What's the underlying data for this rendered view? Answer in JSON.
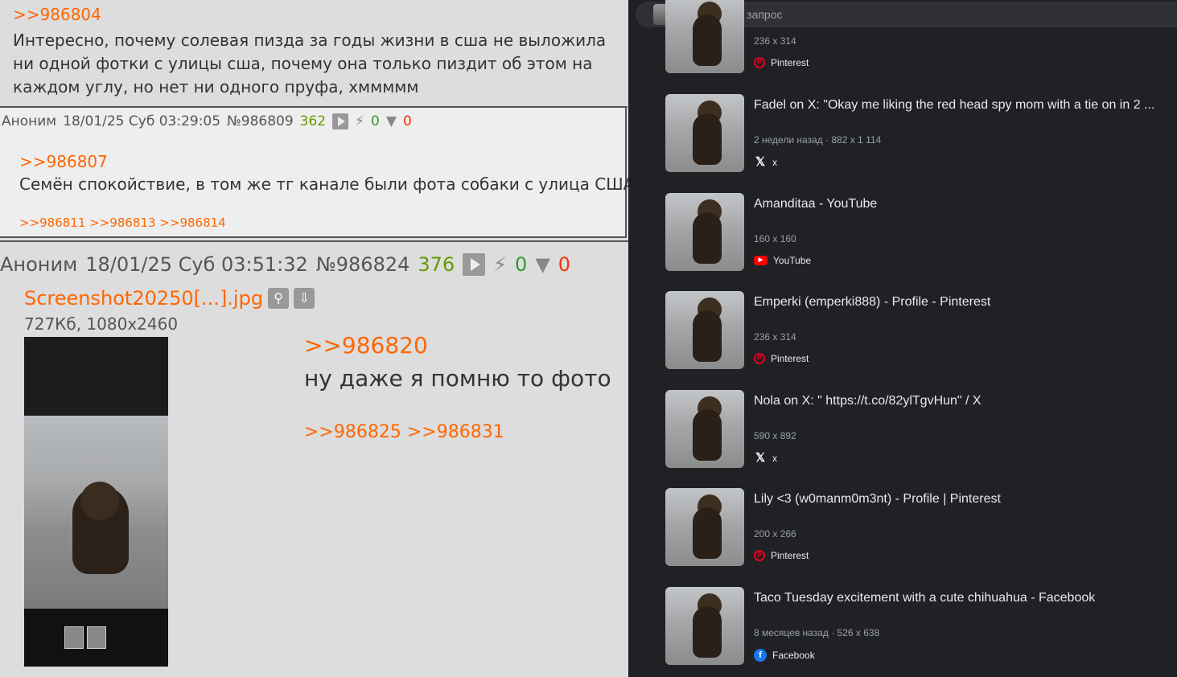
{
  "left": {
    "post1": {
      "reply": ">>986804",
      "text_line1": "Интересно, почему солевая пизда за годы жизни в сша не выложила",
      "text_line2": "ни одной фотки с улицы сша, почему она только пиздит об этом на",
      "text_line3": "каждом углу, но нет ни одного пруфа, хммммм"
    },
    "post2": {
      "author": "Аноним",
      "date": "18/01/25 Суб 03:29:05",
      "number": "№986809",
      "count": "362",
      "likes": "0",
      "dislikes": "0",
      "reply": ">>986807",
      "text": "Семён спокойствие, в том же тг канале были фота собаки с улица США",
      "replies": ">>986811 >>986813 >>986814"
    },
    "post3": {
      "author": "Аноним",
      "date": "18/01/25 Суб 03:51:32",
      "number": "№986824",
      "count": "376",
      "likes": "0",
      "dislikes": "0",
      "file_name": "Screenshot20250[...].jpg",
      "file_info": "727Кб, 1080x2460",
      "reply": ">>986820",
      "text": "ну даже я помню то фото",
      "replies": ">>986825 >>986831"
    }
  },
  "right": {
    "search": {
      "placeholder": "Дополните запрос"
    },
    "results": [
      {
        "title": "",
        "meta": "236 x 314",
        "source": "Pinterest",
        "icon": "pinterest-icon"
      },
      {
        "title": "Fadel on X: \"Okay me liking the red head spy mom with a tie on in 2 ...",
        "meta": "2 недели назад · 882 x 1 114",
        "source": "x",
        "icon": "x-icon"
      },
      {
        "title": "Amanditaa - YouTube",
        "meta": "160 x 160",
        "source": "YouTube",
        "icon": "youtube-icon"
      },
      {
        "title": "Emperki (emperki888) - Profile - Pinterest",
        "meta": "236 x 314",
        "source": "Pinterest",
        "icon": "pinterest-icon"
      },
      {
        "title": "Nola on X: \" https://t.co/82ylTgvHun\" / X",
        "meta": "590 x 892",
        "source": "x",
        "icon": "x-icon"
      },
      {
        "title": "Lily <3 (w0manm0m3nt) - Profile | Pinterest",
        "meta": "200 x 266",
        "source": "Pinterest",
        "icon": "pinterest-icon"
      },
      {
        "title": "Taco Tuesday excitement with a cute chihuahua - Facebook",
        "meta": "8 месяцев назад · 526 x 638",
        "source": "Facebook",
        "icon": "facebook-icon"
      }
    ]
  }
}
